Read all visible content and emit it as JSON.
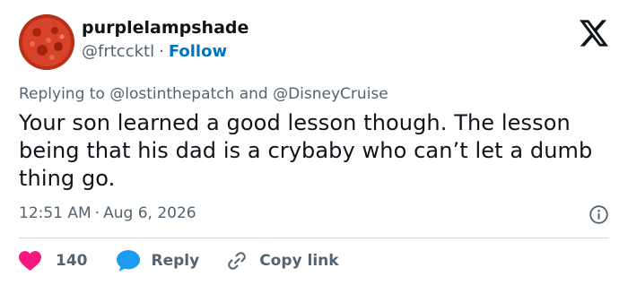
{
  "author": {
    "display_name": "purplelampshade",
    "handle": "@frtccktl",
    "separator": "·",
    "follow_label": "Follow",
    "avatar_icon": "pizza-avatar"
  },
  "brand": {
    "logo_icon": "x-logo-icon"
  },
  "reply_context": {
    "prefix": "Replying to",
    "mention_1": "@lostinthepatch",
    "conjunction": "and",
    "mention_2": "@DisneyCruise"
  },
  "tweet": {
    "text": "Your son learned a good lesson though. The lesson being that his dad is a crybaby who can’t let a dumb thing go.",
    "time": "12:51 AM",
    "separator": "·",
    "date": "Aug 6, 2026"
  },
  "actions": {
    "like_count": "140",
    "reply_label": "Reply",
    "copy_link_label": "Copy link"
  },
  "colors": {
    "text": "#0f1419",
    "muted": "#536471",
    "follow": "#0074c2",
    "like": "#f91880",
    "reply": "#1d9bf0",
    "divider": "#cfd9de"
  }
}
